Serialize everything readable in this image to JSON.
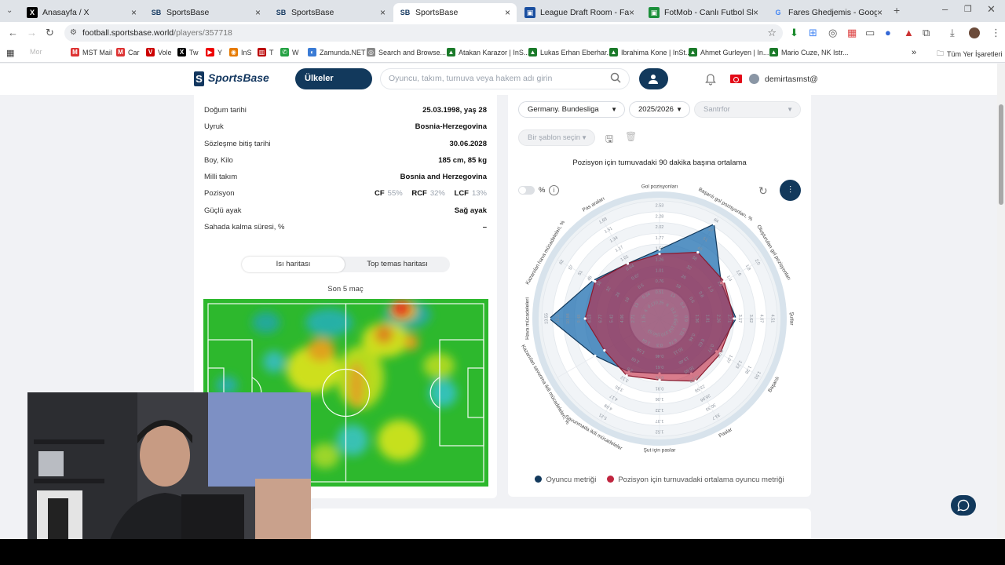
{
  "tabs": [
    {
      "favicon": "X",
      "title": "Anasayfa / X"
    },
    {
      "favicon": "SB",
      "title": "SportsBase"
    },
    {
      "favicon": "SB",
      "title": "SportsBase"
    },
    {
      "favicon": "SB",
      "title": "SportsBase"
    },
    {
      "favicon": "fantrax-icon",
      "title": "League Draft Room - Fantrax"
    },
    {
      "favicon": "fotmob-icon",
      "title": "FotMob - Canlı Futbol Skorları"
    },
    {
      "favicon": "G",
      "title": "Fares Ghedjemis - Google'da A"
    }
  ],
  "address": {
    "host": "football.sportsbase.world",
    "path": "/players/357718"
  },
  "bookmarks": [
    "Mor",
    "MST Mail",
    "Car",
    "Vole",
    "Tw",
    "Y",
    "InS",
    "T",
    "W",
    "Zamunda.NET",
    "Search and Browse...",
    "Atakan Karazor | InS...",
    "Lukas Erhan Eberhar...",
    "Ibrahima Kone | InSt...",
    "Ahmet Gurleyen | In...",
    "Mario Cuze, NK Istr...",
    "Tüm Yer İşaretleri"
  ],
  "header": {
    "logo": "SportsBase",
    "countries_button": "Ülkeler",
    "search_placeholder": "Oyuncu, takım, turnuva veya hakem adı girin",
    "username": "demirtasmst@"
  },
  "player_info": [
    {
      "label": "Doğum tarihi",
      "value": "25.03.1998, yaş 28"
    },
    {
      "label": "Uyruk",
      "value": "Bosnia-Herzegovina"
    },
    {
      "label": "Sözleşme bitiş tarihi",
      "value": "30.06.2028"
    },
    {
      "label": "Boy, Kilo",
      "value": "185 cm, 85 kg"
    },
    {
      "label": "Milli takım",
      "value": "Bosnia and Herzegovina"
    },
    {
      "label": "Pozisyon",
      "value": ""
    },
    {
      "label": "Güçlü ayak",
      "value": "Sağ ayak"
    },
    {
      "label": "Sahada kalma süresi, %",
      "value": "–"
    }
  ],
  "positions": [
    {
      "pos": "CF",
      "pct": "55%"
    },
    {
      "pos": "RCF",
      "pct": "32%"
    },
    {
      "pos": "LCF",
      "pct": "13%"
    }
  ],
  "heatmap": {
    "tab_active": "Isı haritası",
    "tab_inactive": "Top temas haritası",
    "subtitle": "Son 5 maç"
  },
  "filters": {
    "league": "Germany. Bundesliga",
    "season": "2025/2026",
    "position": "Santrfor",
    "template": "Bir şablon seçin"
  },
  "radar": {
    "title": "Pozisyon için turnuvadaki 90 dakika başına ortalama",
    "pct_label": "%",
    "legend_player": "Oyuncu metriği",
    "legend_average": "Pozisyon için turnuvadaki ortalama oyuncu metriği",
    "colors": {
      "player": "#1f6fb0",
      "average": "#c0253f",
      "button": "#12395c"
    }
  },
  "chart_data": {
    "type": "radar",
    "title": "Pozisyon için turnuvadaki 90 dakika başına ortalama",
    "axes": [
      {
        "label": "Gol pozisyonları",
        "ticks": [
          "0.25",
          "0.51",
          "0.76",
          "1.01",
          "1.26",
          "1.52",
          "1.77",
          "2.02",
          "2.28",
          "2.53"
        ]
      },
      {
        "label": "Başarılı gol pozisyonları, %",
        "ticks": [
          "6",
          "13",
          "19",
          "26",
          "32",
          "38",
          "45",
          "51",
          "57",
          "64"
        ]
      },
      {
        "label": "Oluşturulan gol pozisyonları",
        "ticks": [
          "0.2",
          "0.4",
          "0.6",
          "0.8",
          "1.0",
          "1.2",
          "1.4",
          "1.6",
          "1.8",
          "2.0"
        ]
      },
      {
        "label": "Şutlar",
        "ticks": [
          "0.45",
          "0.9",
          "1.36",
          "1.81",
          "2.26",
          "2.71",
          "3.17",
          "3.62",
          "4.07",
          "4.51"
        ]
      },
      {
        "label": "Başarılı",
        "ticks": [
          "0.15",
          "0.31",
          "0.46",
          "0.62",
          "0.77",
          "0.92",
          "1.07",
          "1.23",
          "1.38",
          "1.53"
        ]
      },
      {
        "label": "Paslar",
        "ticks": [
          "3.37",
          "6.74",
          "10.11",
          "13.48",
          "16.85",
          "20.22",
          "23.59",
          "26.96",
          "30.33",
          "33.7"
        ]
      },
      {
        "label": "Şut için paslar",
        "ticks": [
          "0.15",
          "0.3",
          "0.46",
          "0.61",
          "0.76",
          "0.91",
          "1.06",
          "1.22",
          "1.37",
          "1.52"
        ]
      },
      {
        "label": "Savunmada ikili mücadeleler",
        "ticks": [
          "0.52",
          "1.04",
          "1.56",
          "2.08",
          "2.6",
          "3.12",
          "3.65",
          "4.17",
          "4.69",
          "5.21"
        ]
      },
      {
        "label": "Kazanılan savunma ikili mücadeleleri, %",
        "ticks": [
          "",
          "",
          "",
          "",
          "",
          "",
          "",
          "",
          "",
          ""
        ]
      },
      {
        "label": "Hava mücadeleleri",
        "ticks": [
          "1.35",
          "2.71",
          "4.06",
          "5.42",
          "6.77",
          "8.13",
          "9.48",
          "10.84",
          "12.2",
          "13.55"
        ]
      },
      {
        "label": "Kazanılan hava mücadeleleri, %",
        "ticks": [
          "6",
          "13",
          "19",
          "26",
          "32",
          "38",
          "45",
          "51",
          "57",
          "62"
        ]
      },
      {
        "label": "Pas araları",
        "ticks": [
          "0.17",
          "0.34",
          "0.5",
          "0.67",
          "0.84",
          "1.01",
          "1.17",
          "1.34",
          "1.51",
          "1.68"
        ]
      }
    ],
    "series": [
      {
        "name": "Oyuncu metriği",
        "values": [
          0.55,
          0.92,
          0.57,
          0.62,
          0.52,
          0.5,
          0.42,
          0.48,
          0.6,
          0.93,
          0.62,
          0.5
        ]
      },
      {
        "name": "Pozisyon için turnuvadaki ortalama oyuncu metriği",
        "values": [
          0.51,
          0.62,
          0.6,
          0.6,
          0.56,
          0.58,
          0.48,
          0.52,
          0.5,
          0.6,
          0.6,
          0.5
        ]
      }
    ]
  }
}
